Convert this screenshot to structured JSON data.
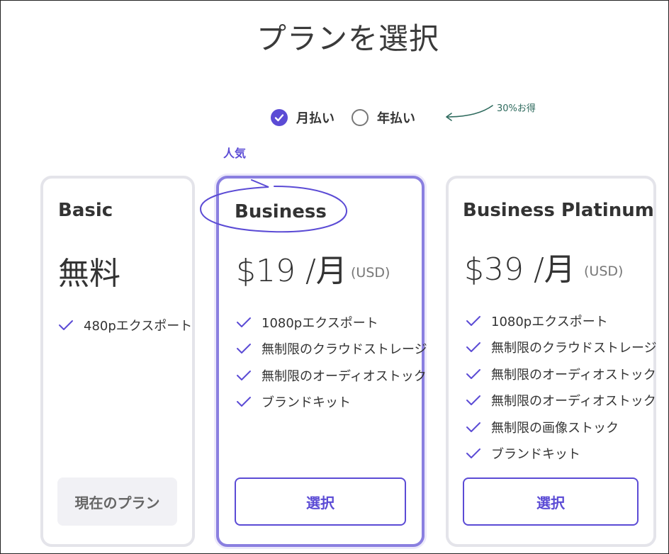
{
  "page": {
    "title": "プランを選択"
  },
  "billing": {
    "monthly_label": "月払い",
    "yearly_label": "年払い",
    "selected": "monthly",
    "discount_note": "30%お得"
  },
  "popular_label": "人気",
  "colors": {
    "accent": "#5b4bd5",
    "card_border": "#e4e4ea",
    "featured_border": "#8a7fe0",
    "annotation": "#2f6b5e"
  },
  "icons": {
    "check": "check-icon",
    "radio_checked": "radio-checked-icon",
    "radio_unchecked": "radio-unchecked-icon",
    "arrow": "curved-arrow-icon"
  },
  "plans": [
    {
      "name": "Basic",
      "price": "無料",
      "currency": "",
      "features": [
        "480pエクスポート"
      ],
      "button_label": "現在のプラン"
    },
    {
      "name": "Business",
      "price": "$19 /月",
      "currency": "(USD)",
      "features": [
        "1080pエクスポート",
        "無制限のクラウドストレージ",
        "無制限のオーディオストック",
        "ブランドキット"
      ],
      "button_label": "選択"
    },
    {
      "name": "Business Platinum",
      "price": "$39 /月",
      "currency": "(USD)",
      "features": [
        "1080pエクスポート",
        "無制限のクラウドストレージ",
        "無制限のオーディオストック",
        "無制限のオーディオストック",
        "無制限の画像ストック",
        "ブランドキット"
      ],
      "button_label": "選択"
    }
  ]
}
